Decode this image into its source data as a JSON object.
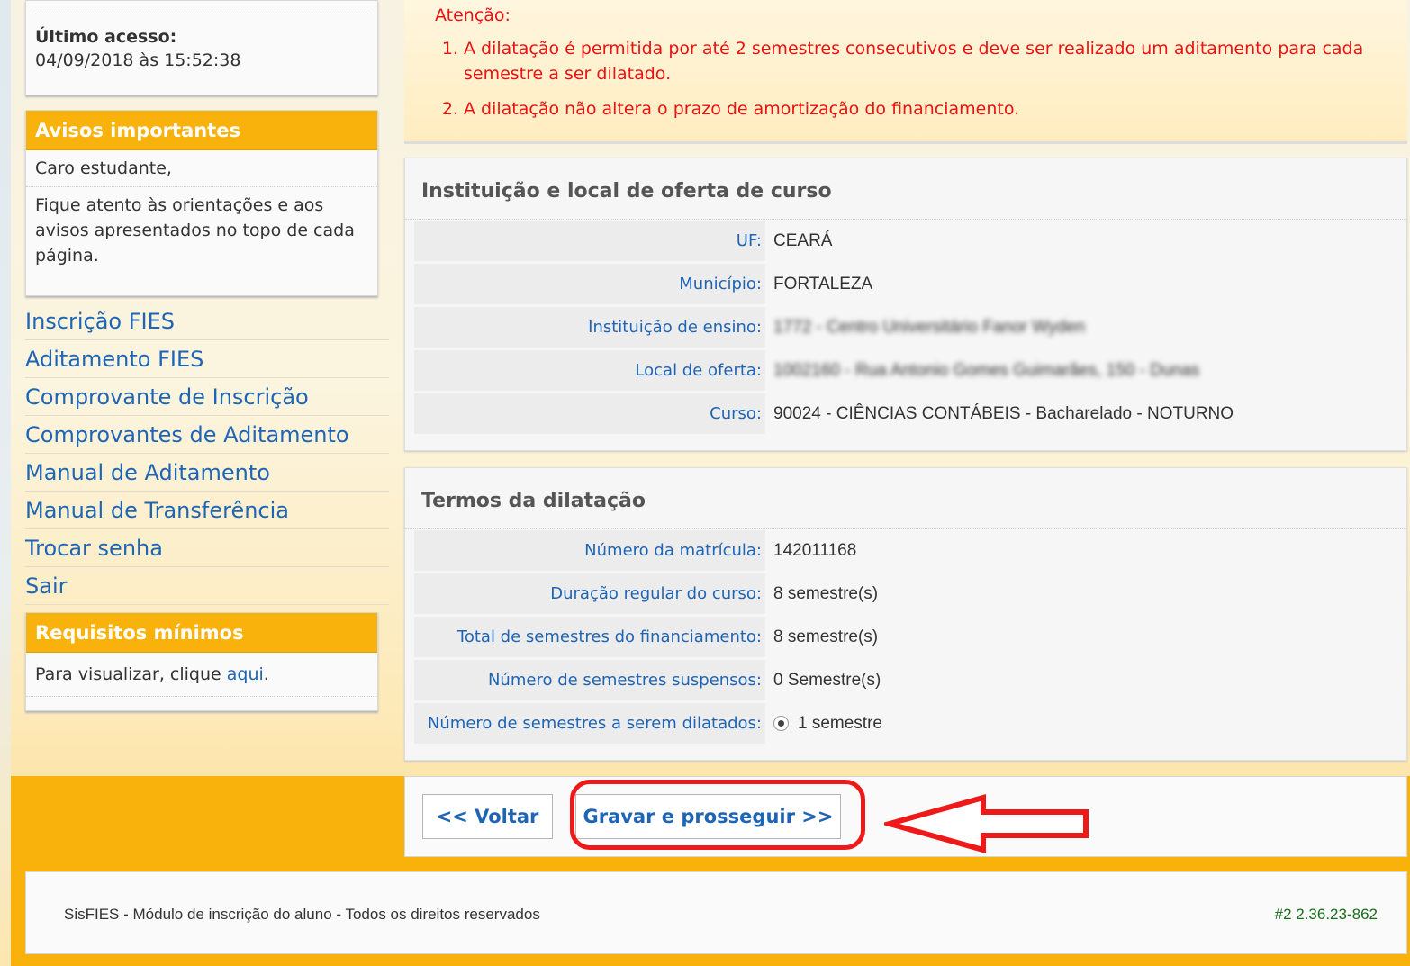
{
  "sidebar": {
    "last_access": {
      "label": "Último acesso:",
      "value": "04/09/2018 às 15:52:38"
    },
    "avisos": {
      "title": "Avisos importantes",
      "greeting": "Caro estudante,",
      "message": "Fique atento às orientações e aos avisos apresentados no topo de cada página."
    },
    "nav": [
      "Inscrição FIES",
      "Aditamento FIES",
      "Comprovante de Inscrição",
      "Comprovantes de Aditamento",
      "Manual de Aditamento",
      "Manual de Transferência",
      "Trocar senha",
      "Sair"
    ],
    "requisitos": {
      "title": "Requisitos mínimos",
      "text": "Para visualizar, clique ",
      "link": "aqui",
      "suffix": "."
    }
  },
  "alert": {
    "title": "Atenção:",
    "items": [
      "A dilatação é permitida por até 2 semestres consecutivos e deve ser realizado um aditamento para cada semestre a ser dilatado.",
      "A dilatação não altera o prazo de amortização do financiamento."
    ]
  },
  "institution": {
    "title": "Instituição e local de oferta de curso",
    "rows": [
      {
        "label": "UF:",
        "value": "CEARÁ"
      },
      {
        "label": "Município:",
        "value": "FORTALEZA"
      },
      {
        "label": "Instituição de ensino:",
        "value": "1772 - Centro Universitário Fanor Wyden"
      },
      {
        "label": "Local de oferta:",
        "value": "1002160 - Rua Antonio Gomes Guimarães, 150 - Dunas"
      },
      {
        "label": "Curso:",
        "value": "90024 - CIÊNCIAS CONTÁBEIS - Bacharelado - NOTURNO"
      }
    ]
  },
  "terms": {
    "title": "Termos da dilatação",
    "rows": [
      {
        "label": "Número da matrícula:",
        "value": "142011168"
      },
      {
        "label": "Duração regular do curso:",
        "value": "8 semestre(s)"
      },
      {
        "label": "Total de semestres do financiamento:",
        "value": "8 semestre(s)"
      },
      {
        "label": "Número de semestres suspensos:",
        "value": "0 Semestre(s)"
      },
      {
        "label": "Número de semestres a serem dilatados:",
        "value": "1 semestre"
      }
    ]
  },
  "actions": {
    "back": "<< Voltar",
    "save": "Gravar e prosseguir >>"
  },
  "footer": {
    "left": "SisFIES - Módulo de inscrição do aluno - Todos os direitos reservados",
    "right": "#2 2.36.23-862"
  },
  "colors": {
    "accent_orange": "#f9b20b",
    "link_blue": "#1f65b5",
    "alert_red": "#ee1111",
    "annotation_red": "#ee1a1a"
  }
}
